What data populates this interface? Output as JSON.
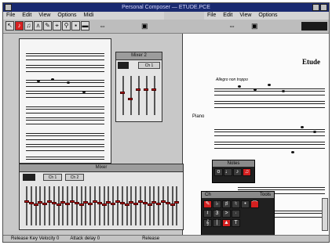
{
  "window": {
    "title": "Personal Composer — ETUDE.PCE"
  },
  "menu_left": [
    "File",
    "Edit",
    "View",
    "Options",
    "Midi"
  ],
  "menu_right": [
    "File",
    "Edit",
    "View",
    "Options"
  ],
  "score": {
    "title": "Etude",
    "tempo": "Allegro non troppo",
    "instrument": "Piano"
  },
  "mixer_small": {
    "title": "Mixer 2",
    "button": "Ch 1"
  },
  "mixer_big": {
    "title": "Mixer",
    "buttons": [
      "Ch 1",
      "Ch 2"
    ]
  },
  "notes_palette": {
    "title": "Notes"
  },
  "tools_palette": {
    "title": "Tools",
    "label_left": "Ch"
  },
  "status": {
    "release_velocity": "Release Key Velocity  0",
    "attack_delay": "Attack delay  0",
    "release": "Release"
  },
  "colors": {
    "titlebar": "#1a2a70",
    "accent_red": "#d62020",
    "panel": "#e4e4e4"
  }
}
